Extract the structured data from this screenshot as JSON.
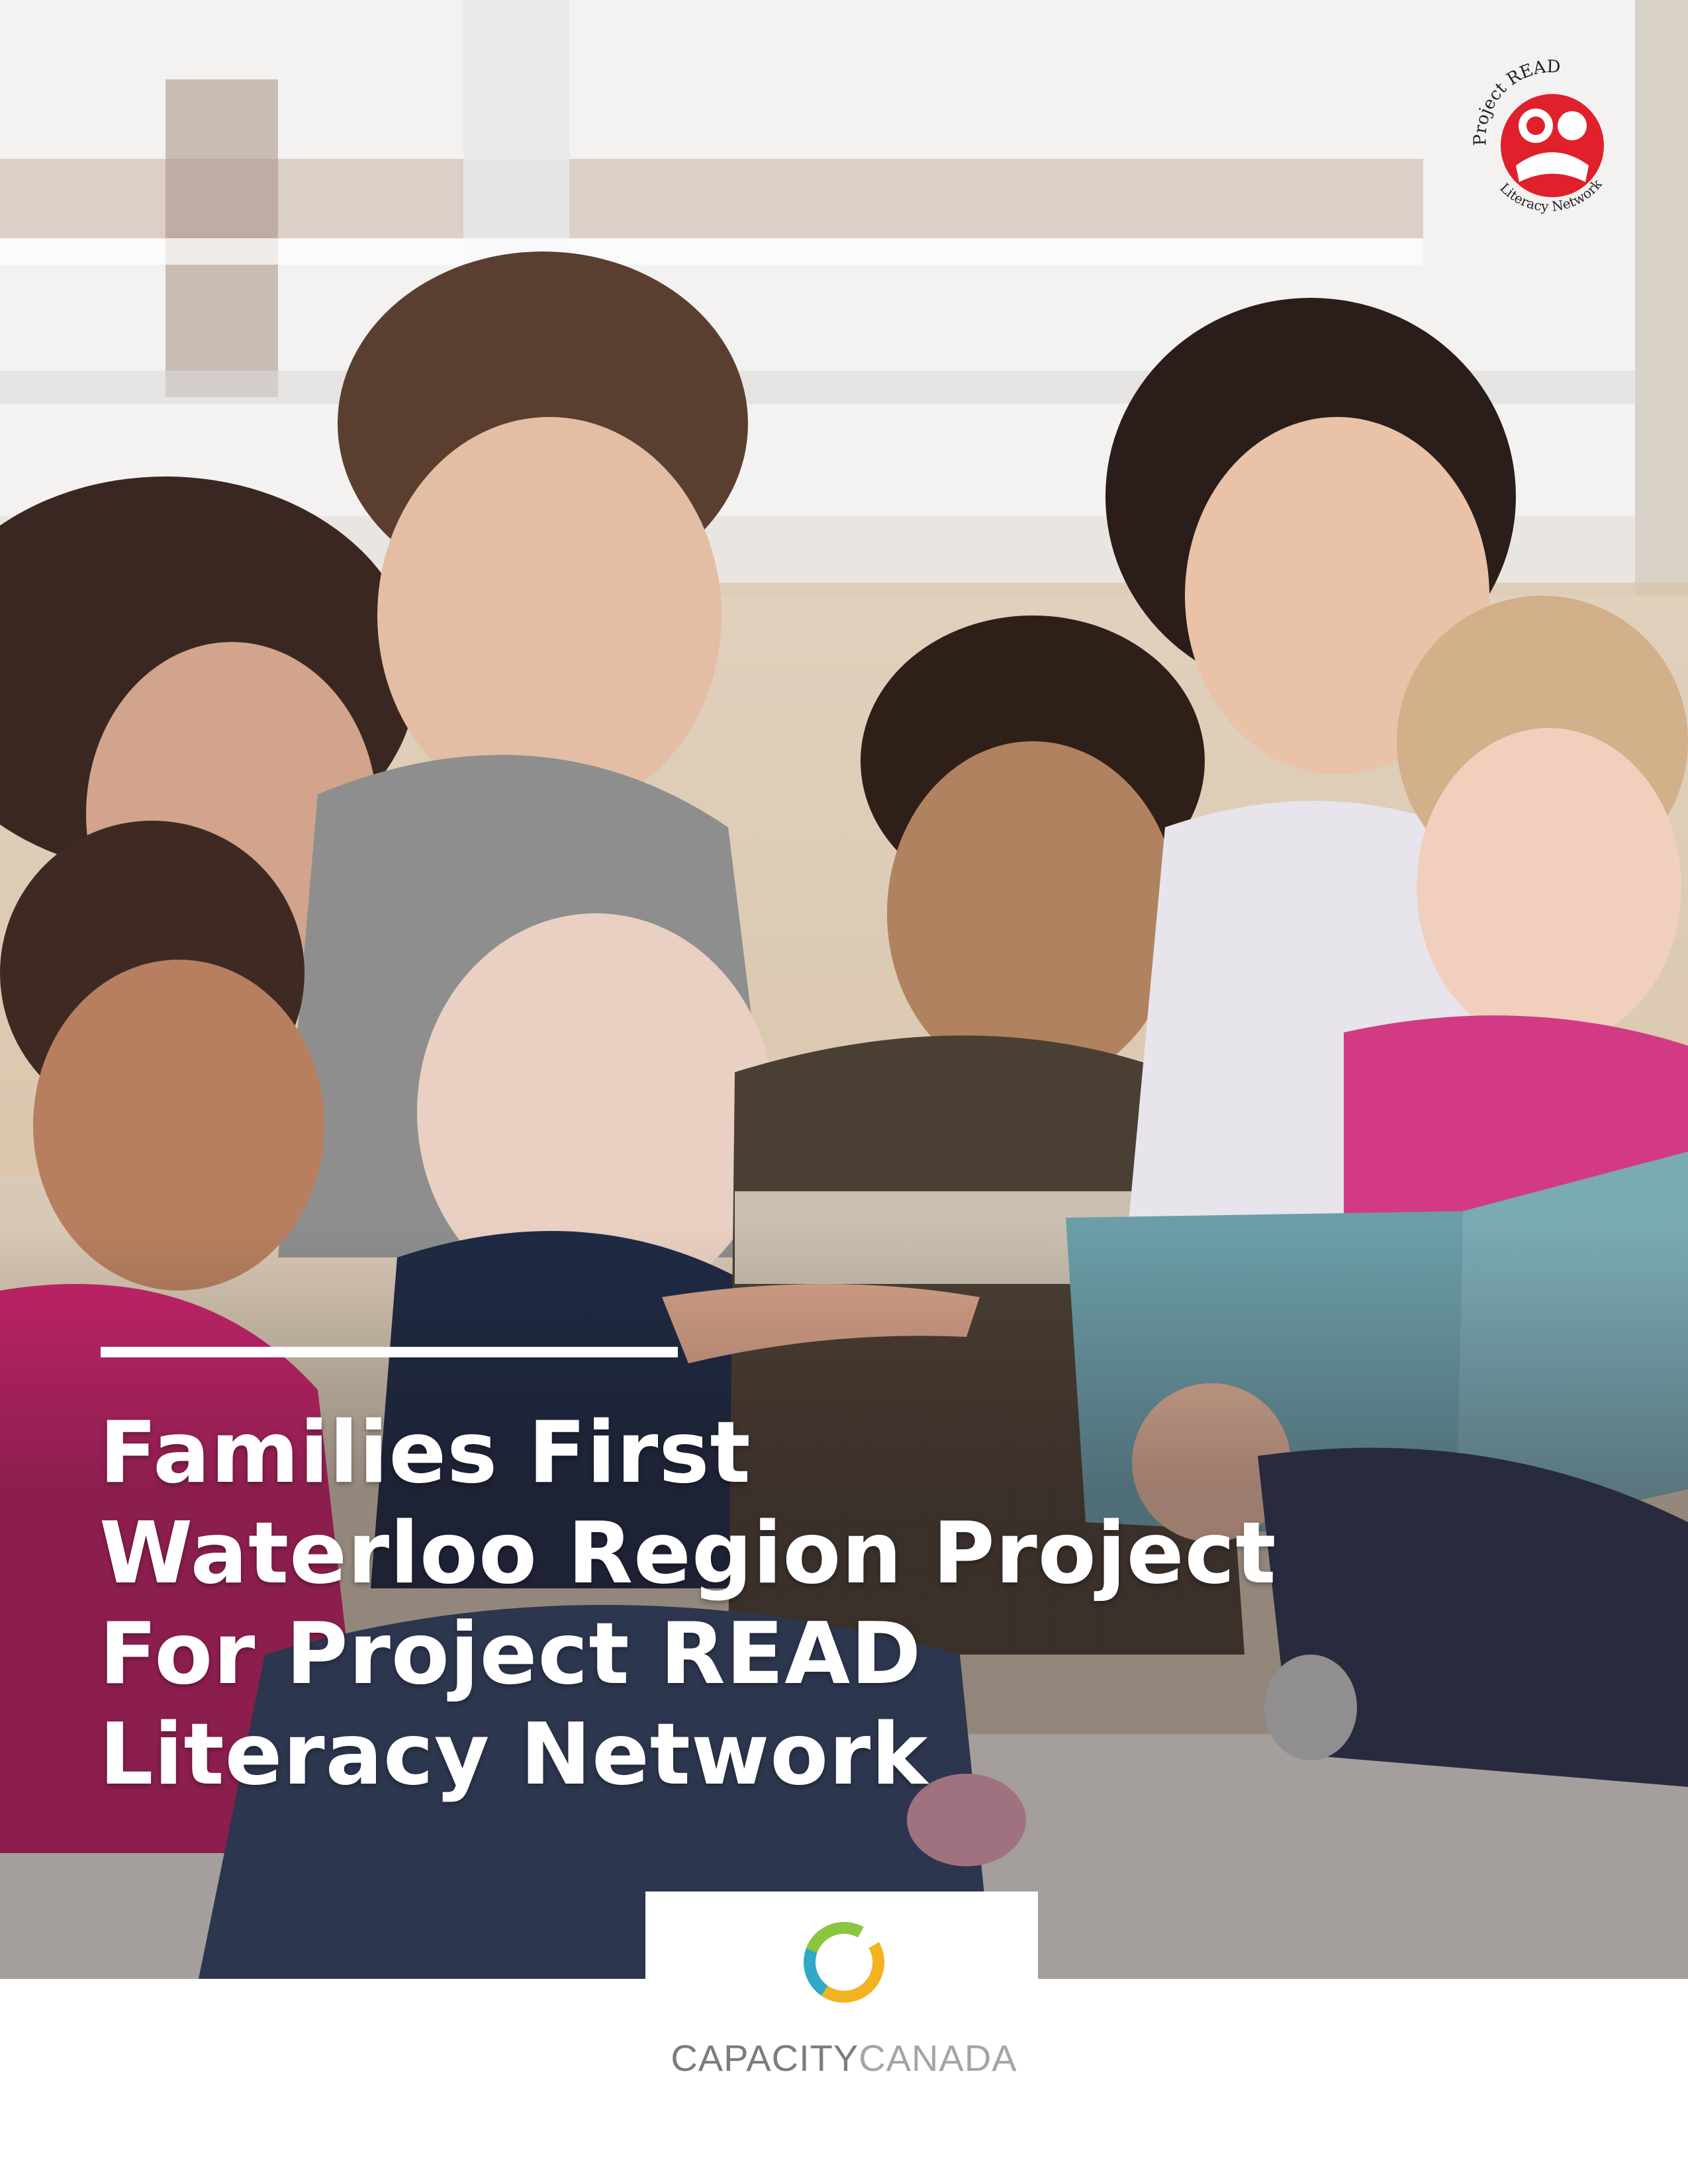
{
  "cover": {
    "title_lines": [
      "Families First",
      "Waterloo Region Project",
      "For Project READ",
      "Literacy Network"
    ]
  },
  "logos": {
    "project_read": {
      "icon": "project-read-logo",
      "text_top": "Project READ",
      "text_bottom": "Literacy Network",
      "color": "#e0202a"
    },
    "capacity_canada": {
      "icon": "capacity-canada-ring",
      "word_part1": "CAPACITY",
      "word_part2": "CANADA",
      "colors": [
        "#f2b321",
        "#8cc63f",
        "#2fa9c6"
      ]
    }
  },
  "photo": {
    "description_icon": "family-reading-photo"
  }
}
